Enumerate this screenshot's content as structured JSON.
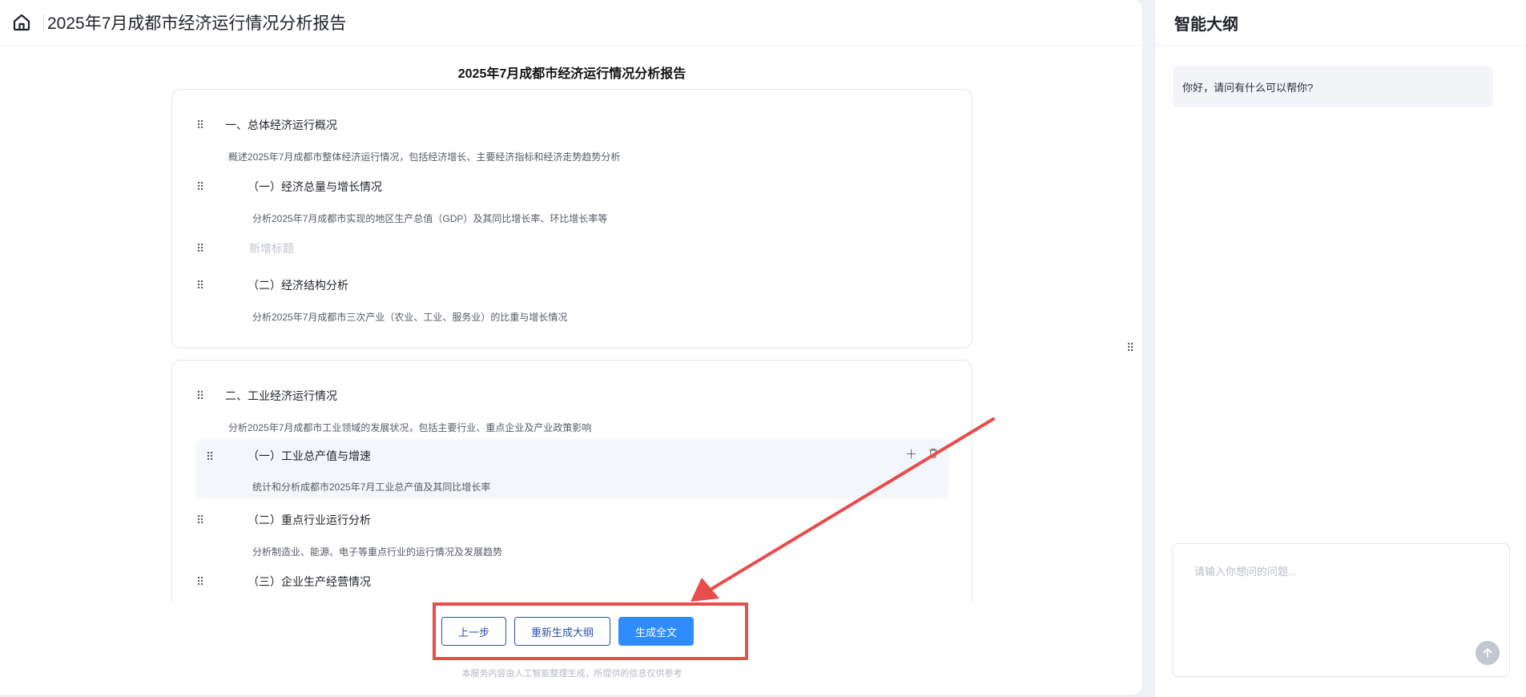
{
  "header": {
    "home_icon": "home-icon",
    "title": "2025年7月成都市经济运行情况分析报告"
  },
  "outline": {
    "title": "2025年7月成都市经济运行情况分析报告",
    "sections": [
      {
        "heading": "一、总体经济运行概况",
        "desc": "概述2025年7月成都市整体经济运行情况，包括经济增长、主要经济指标和经济走势趋势分析",
        "items": [
          {
            "heading": "（一）经济总量与增长情况",
            "desc": "分析2025年7月成都市实现的地区生产总值（GDP）及其同比增长率、环比增长率等"
          },
          {
            "placeholder": "新增标题"
          },
          {
            "heading": "（二）经济结构分析",
            "desc": "分析2025年7月成都市三次产业（农业、工业、服务业）的比重与增长情况"
          }
        ]
      },
      {
        "heading": "二、工业经济运行情况",
        "desc": "分析2025年7月成都市工业领域的发展状况，包括主要行业、重点企业及产业政策影响",
        "items": [
          {
            "heading": "（一）工业总产值与增速",
            "desc": "统计和分析成都市2025年7月工业总产值及其同比增长率"
          },
          {
            "heading": "（二）重点行业运行分析",
            "desc": "分析制造业、能源、电子等重点行业的运行情况及发展趋势"
          },
          {
            "heading": "（三）企业生产经营情况"
          }
        ]
      }
    ]
  },
  "actions": {
    "prev": "上一步",
    "regenerate": "重新生成大纲",
    "generate": "生成全文"
  },
  "disclaimer": "本服务内容由人工智能整理生成，所提供的信息仅供参考",
  "sidebar": {
    "title": "智能大纲",
    "greeting": "你好，请问有什么可以帮你?",
    "input_placeholder": "请输入你想问的问题...",
    "send_icon": "arrow-up-icon"
  },
  "colors": {
    "primary": "#2f8cff",
    "outline_button": "#2e4fae",
    "annotation": "#ea4b4b"
  }
}
